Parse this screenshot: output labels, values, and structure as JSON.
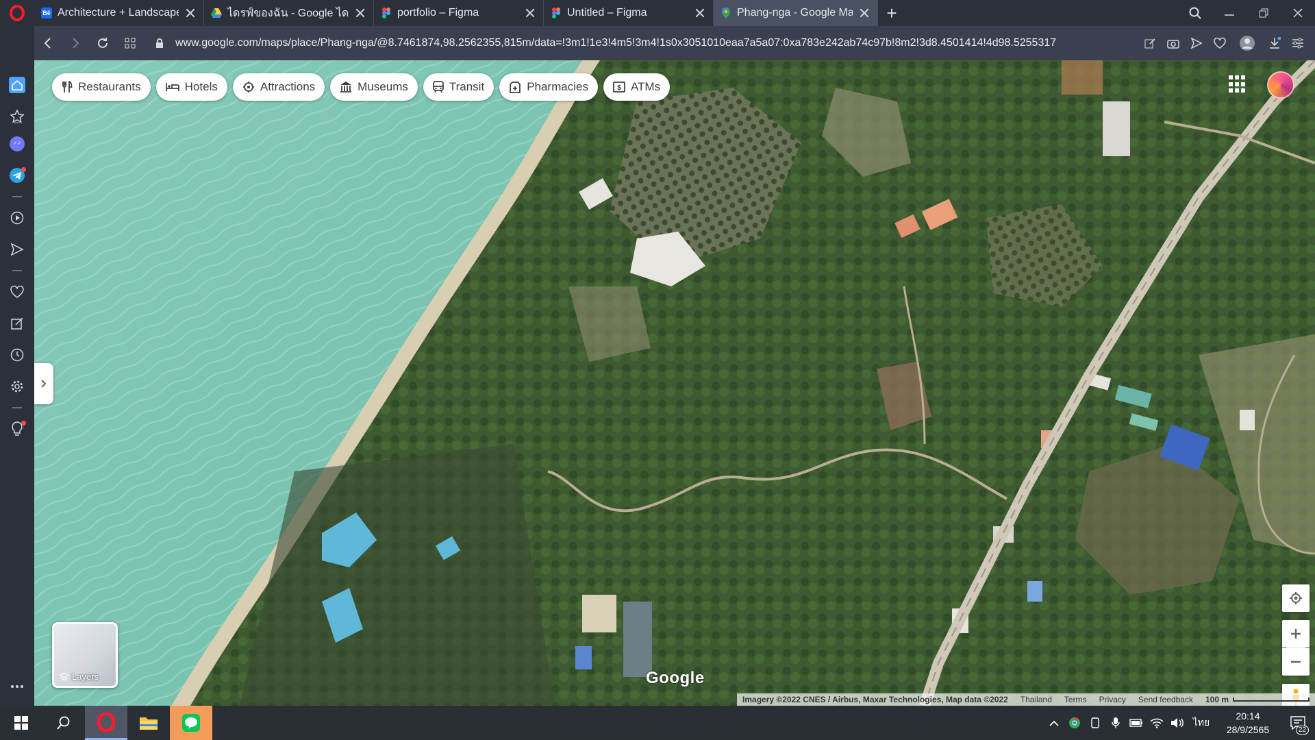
{
  "browser": {
    "tabs": [
      {
        "title": "Architecture + Landscape P",
        "favicon": "behance-icon",
        "active": false
      },
      {
        "title": "ไดรฟ์ของฉัน - Google ไดรฟ์",
        "favicon": "google-drive-icon",
        "active": false
      },
      {
        "title": "portfolio – Figma",
        "favicon": "figma-icon",
        "active": false
      },
      {
        "title": "Untitled – Figma",
        "favicon": "figma-icon",
        "active": false
      },
      {
        "title": "Phang-nga - Google Maps",
        "favicon": "google-maps-icon",
        "active": true
      }
    ],
    "url": "www.google.com/maps/place/Phang-nga/@8.7461874,98.2562355,815m/data=!3m1!1e3!4m5!3m4!1s0x3051010eaa7a5a07:0xa783e242ab74c97b!8m2!3d8.4501414!4d98.5255317"
  },
  "sidebar": {
    "items": [
      "home-icon",
      "bookmarks-icon",
      "messenger-icon",
      "telegram-icon",
      "player-icon",
      "send-flow-icon",
      "heart-icon",
      "pinboard-icon",
      "history-icon",
      "settings-icon",
      "lightbulb-icon",
      "more-icon"
    ]
  },
  "map": {
    "chips": [
      {
        "label": "Restaurants",
        "icon": "restaurant-icon"
      },
      {
        "label": "Hotels",
        "icon": "hotel-icon"
      },
      {
        "label": "Attractions",
        "icon": "attraction-icon"
      },
      {
        "label": "Museums",
        "icon": "museum-icon"
      },
      {
        "label": "Transit",
        "icon": "transit-icon"
      },
      {
        "label": "Pharmacies",
        "icon": "pharmacy-icon"
      },
      {
        "label": "ATMs",
        "icon": "atm-icon"
      }
    ],
    "layers_label": "Layers",
    "google_logo": "Google",
    "footer": {
      "imagery": "Imagery ©2022 CNES / Airbus, Maxar Technologies, Map data ©2022",
      "country": "Thailand",
      "terms": "Terms",
      "privacy": "Privacy",
      "feedback": "Send feedback",
      "scale": "100 m"
    }
  },
  "taskbar": {
    "language": "ไทย",
    "time": "20:14",
    "date": "28/9/2565",
    "notification_count": "22"
  },
  "colors": {
    "sea": "#7fc4b3",
    "vegetation": "#3f5a32",
    "road": "#c9c2b0",
    "accent_red": "#ff1b2d"
  }
}
